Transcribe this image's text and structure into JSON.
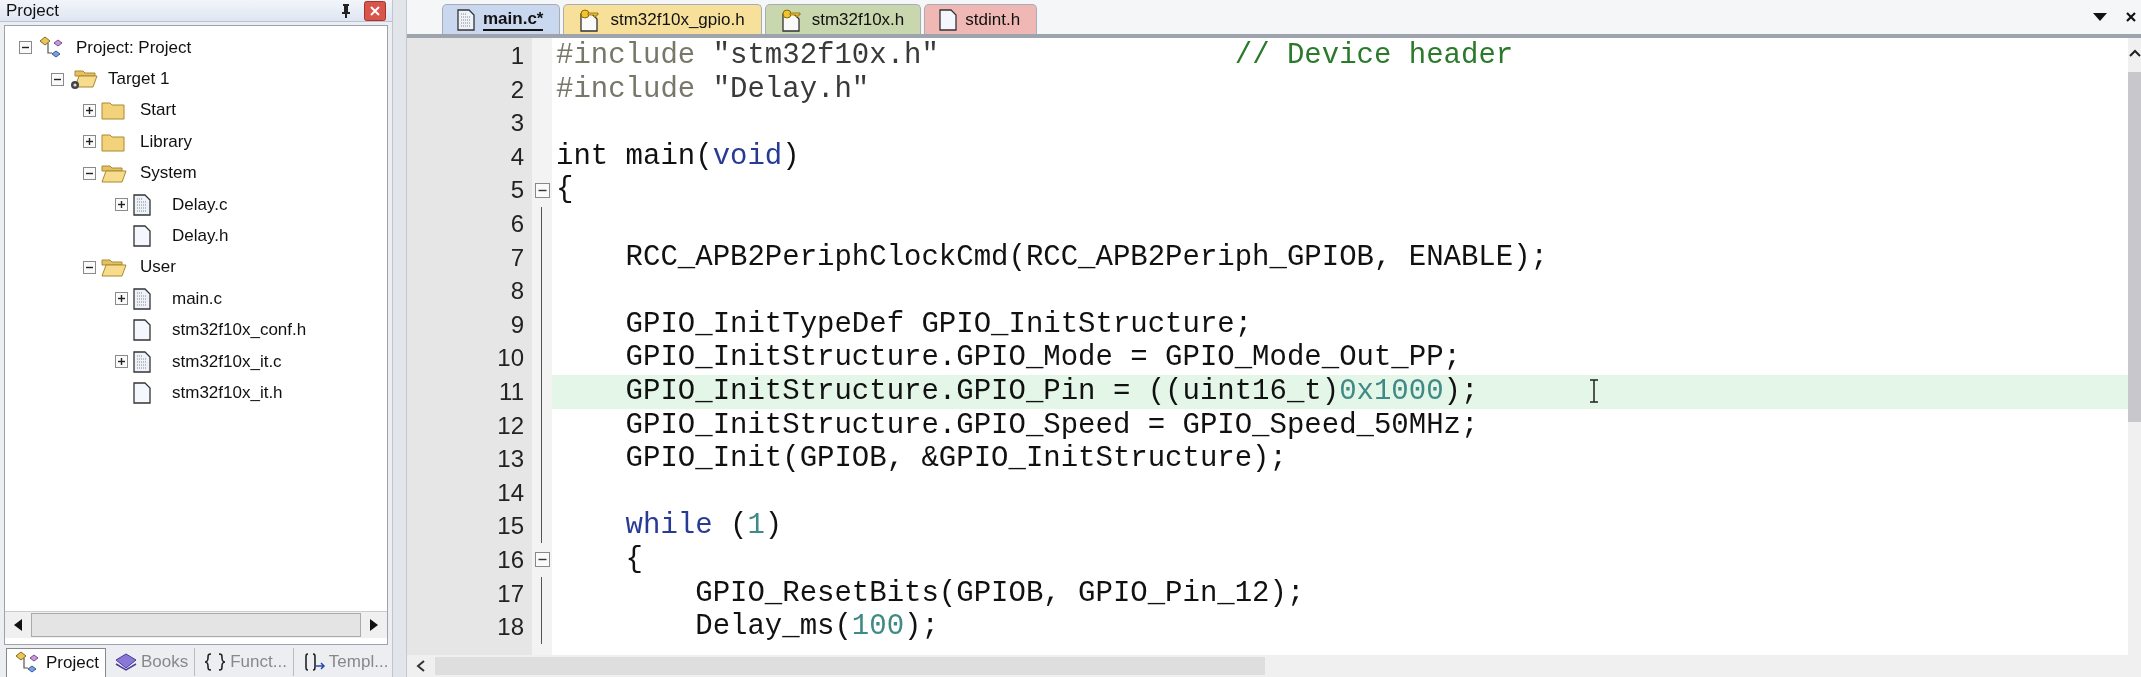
{
  "project_panel": {
    "title": "Project",
    "tree": [
      {
        "label": "Project: Project",
        "kind": "project",
        "expanded": true,
        "children": [
          {
            "label": "Target 1",
            "kind": "target",
            "expanded": true,
            "children": [
              {
                "label": "Start",
                "kind": "folder",
                "expanded": false
              },
              {
                "label": "Library",
                "kind": "folder",
                "expanded": false
              },
              {
                "label": "System",
                "kind": "folder",
                "expanded": true,
                "children": [
                  {
                    "label": "Delay.c",
                    "kind": "source",
                    "expanded": false
                  },
                  {
                    "label": "Delay.h",
                    "kind": "header"
                  }
                ]
              },
              {
                "label": "User",
                "kind": "folder",
                "expanded": true,
                "children": [
                  {
                    "label": "main.c",
                    "kind": "source",
                    "expanded": false
                  },
                  {
                    "label": "stm32f10x_conf.h",
                    "kind": "header"
                  },
                  {
                    "label": "stm32f10x_it.c",
                    "kind": "source",
                    "expanded": false
                  },
                  {
                    "label": "stm32f10x_it.h",
                    "kind": "header"
                  }
                ]
              }
            ]
          }
        ]
      }
    ],
    "bottom_tabs": [
      {
        "label": "Project",
        "kind": "project",
        "selected": true
      },
      {
        "label": "Books",
        "kind": "books",
        "selected": false
      },
      {
        "label": "Funct...",
        "kind": "functions",
        "selected": false
      },
      {
        "label": "Templ...",
        "kind": "templates",
        "selected": false
      }
    ]
  },
  "editor": {
    "tabs": [
      {
        "label": "main.c*",
        "kind": "source",
        "color": "#c9d7ef",
        "selected": true
      },
      {
        "label": "stm32f10x_gpio.h",
        "kind": "key",
        "color": "#f7e19a",
        "selected": false
      },
      {
        "label": "stm32f10x.h",
        "kind": "key",
        "color": "#c9d7ae",
        "selected": false
      },
      {
        "label": "stdint.h",
        "kind": "page",
        "color": "#f0b8b4",
        "selected": false
      }
    ],
    "lines": [
      {
        "number": "1",
        "current": false,
        "kind": "plain",
        "tokens": [
          {
            "text": "#include ",
            "kind": "pre"
          },
          {
            "text": "\"stm32f10x.h\"",
            "kind": "str"
          },
          {
            "text": "                 // Device header",
            "kind": "comment"
          }
        ]
      },
      {
        "number": "2",
        "current": false,
        "kind": "plain",
        "tokens": [
          {
            "text": "#include ",
            "kind": "pre"
          },
          {
            "text": "\"Delay.h\"",
            "kind": "str"
          }
        ]
      },
      {
        "number": "3",
        "current": false,
        "kind": "plain"
      },
      {
        "number": "4",
        "current": false,
        "kind": "plain",
        "tokens": [
          {
            "text": "int main(",
            "kind": "plain"
          },
          {
            "text": "void",
            "kind": "kw"
          },
          {
            "text": ")",
            "kind": "plain"
          }
        ]
      },
      {
        "number": "5",
        "current": false,
        "kind": "fold-start",
        "tokens": [
          {
            "text": "{",
            "kind": "plain"
          }
        ]
      },
      {
        "number": "6",
        "current": false,
        "kind": "fold-body"
      },
      {
        "number": "7",
        "current": false,
        "kind": "fold-body",
        "tokens": [
          {
            "text": "    RCC_APB2PeriphClockCmd(RCC_APB2Periph_GPIOB, ENABLE);",
            "kind": "plain"
          }
        ]
      },
      {
        "number": "8",
        "current": false,
        "kind": "fold-body"
      },
      {
        "number": "9",
        "current": false,
        "kind": "fold-body",
        "tokens": [
          {
            "text": "    GPIO_InitTypeDef GPIO_InitStructure;",
            "kind": "plain"
          }
        ]
      },
      {
        "number": "10",
        "current": false,
        "kind": "fold-body",
        "tokens": [
          {
            "text": "    GPIO_InitStructure.GPIO_Mode = GPIO_Mode_Out_PP;",
            "kind": "plain"
          }
        ]
      },
      {
        "number": "11",
        "current": true,
        "kind": "fold-body",
        "tokens": [
          {
            "text": "    GPIO_InitStructure.GPIO_Pin = ((uint16_t)",
            "kind": "plain"
          },
          {
            "text": "0x1000",
            "kind": "num"
          },
          {
            "text": ");",
            "kind": "plain"
          }
        ]
      },
      {
        "number": "12",
        "current": false,
        "kind": "fold-body",
        "tokens": [
          {
            "text": "    GPIO_InitStructure.GPIO_Speed = GPIO_Speed_50MHz;",
            "kind": "plain"
          }
        ]
      },
      {
        "number": "13",
        "current": false,
        "kind": "fold-body",
        "tokens": [
          {
            "text": "    GPIO_Init(GPIOB, &GPIO_InitStructure);",
            "kind": "plain"
          }
        ]
      },
      {
        "number": "14",
        "current": false,
        "kind": "fold-body"
      },
      {
        "number": "15",
        "current": false,
        "kind": "fold-body",
        "tokens": [
          {
            "text": "    while",
            "kind": "kw"
          },
          {
            "text": " (",
            "kind": "plain"
          },
          {
            "text": "1",
            "kind": "num"
          },
          {
            "text": ")",
            "kind": "plain"
          }
        ]
      },
      {
        "number": "16",
        "current": false,
        "kind": "fold-start",
        "tokens": [
          {
            "text": "    {",
            "kind": "plain"
          }
        ]
      },
      {
        "number": "17",
        "current": false,
        "kind": "fold-body",
        "tokens": [
          {
            "text": "        GPIO_ResetBits(GPIOB, GPIO_Pin_12);",
            "kind": "plain"
          }
        ]
      },
      {
        "number": "18",
        "current": false,
        "kind": "fold-body",
        "tokens": [
          {
            "text": "        Delay_ms(",
            "kind": "plain"
          },
          {
            "text": "100",
            "kind": "num"
          },
          {
            "text": ");",
            "kind": "plain"
          }
        ]
      }
    ]
  }
}
